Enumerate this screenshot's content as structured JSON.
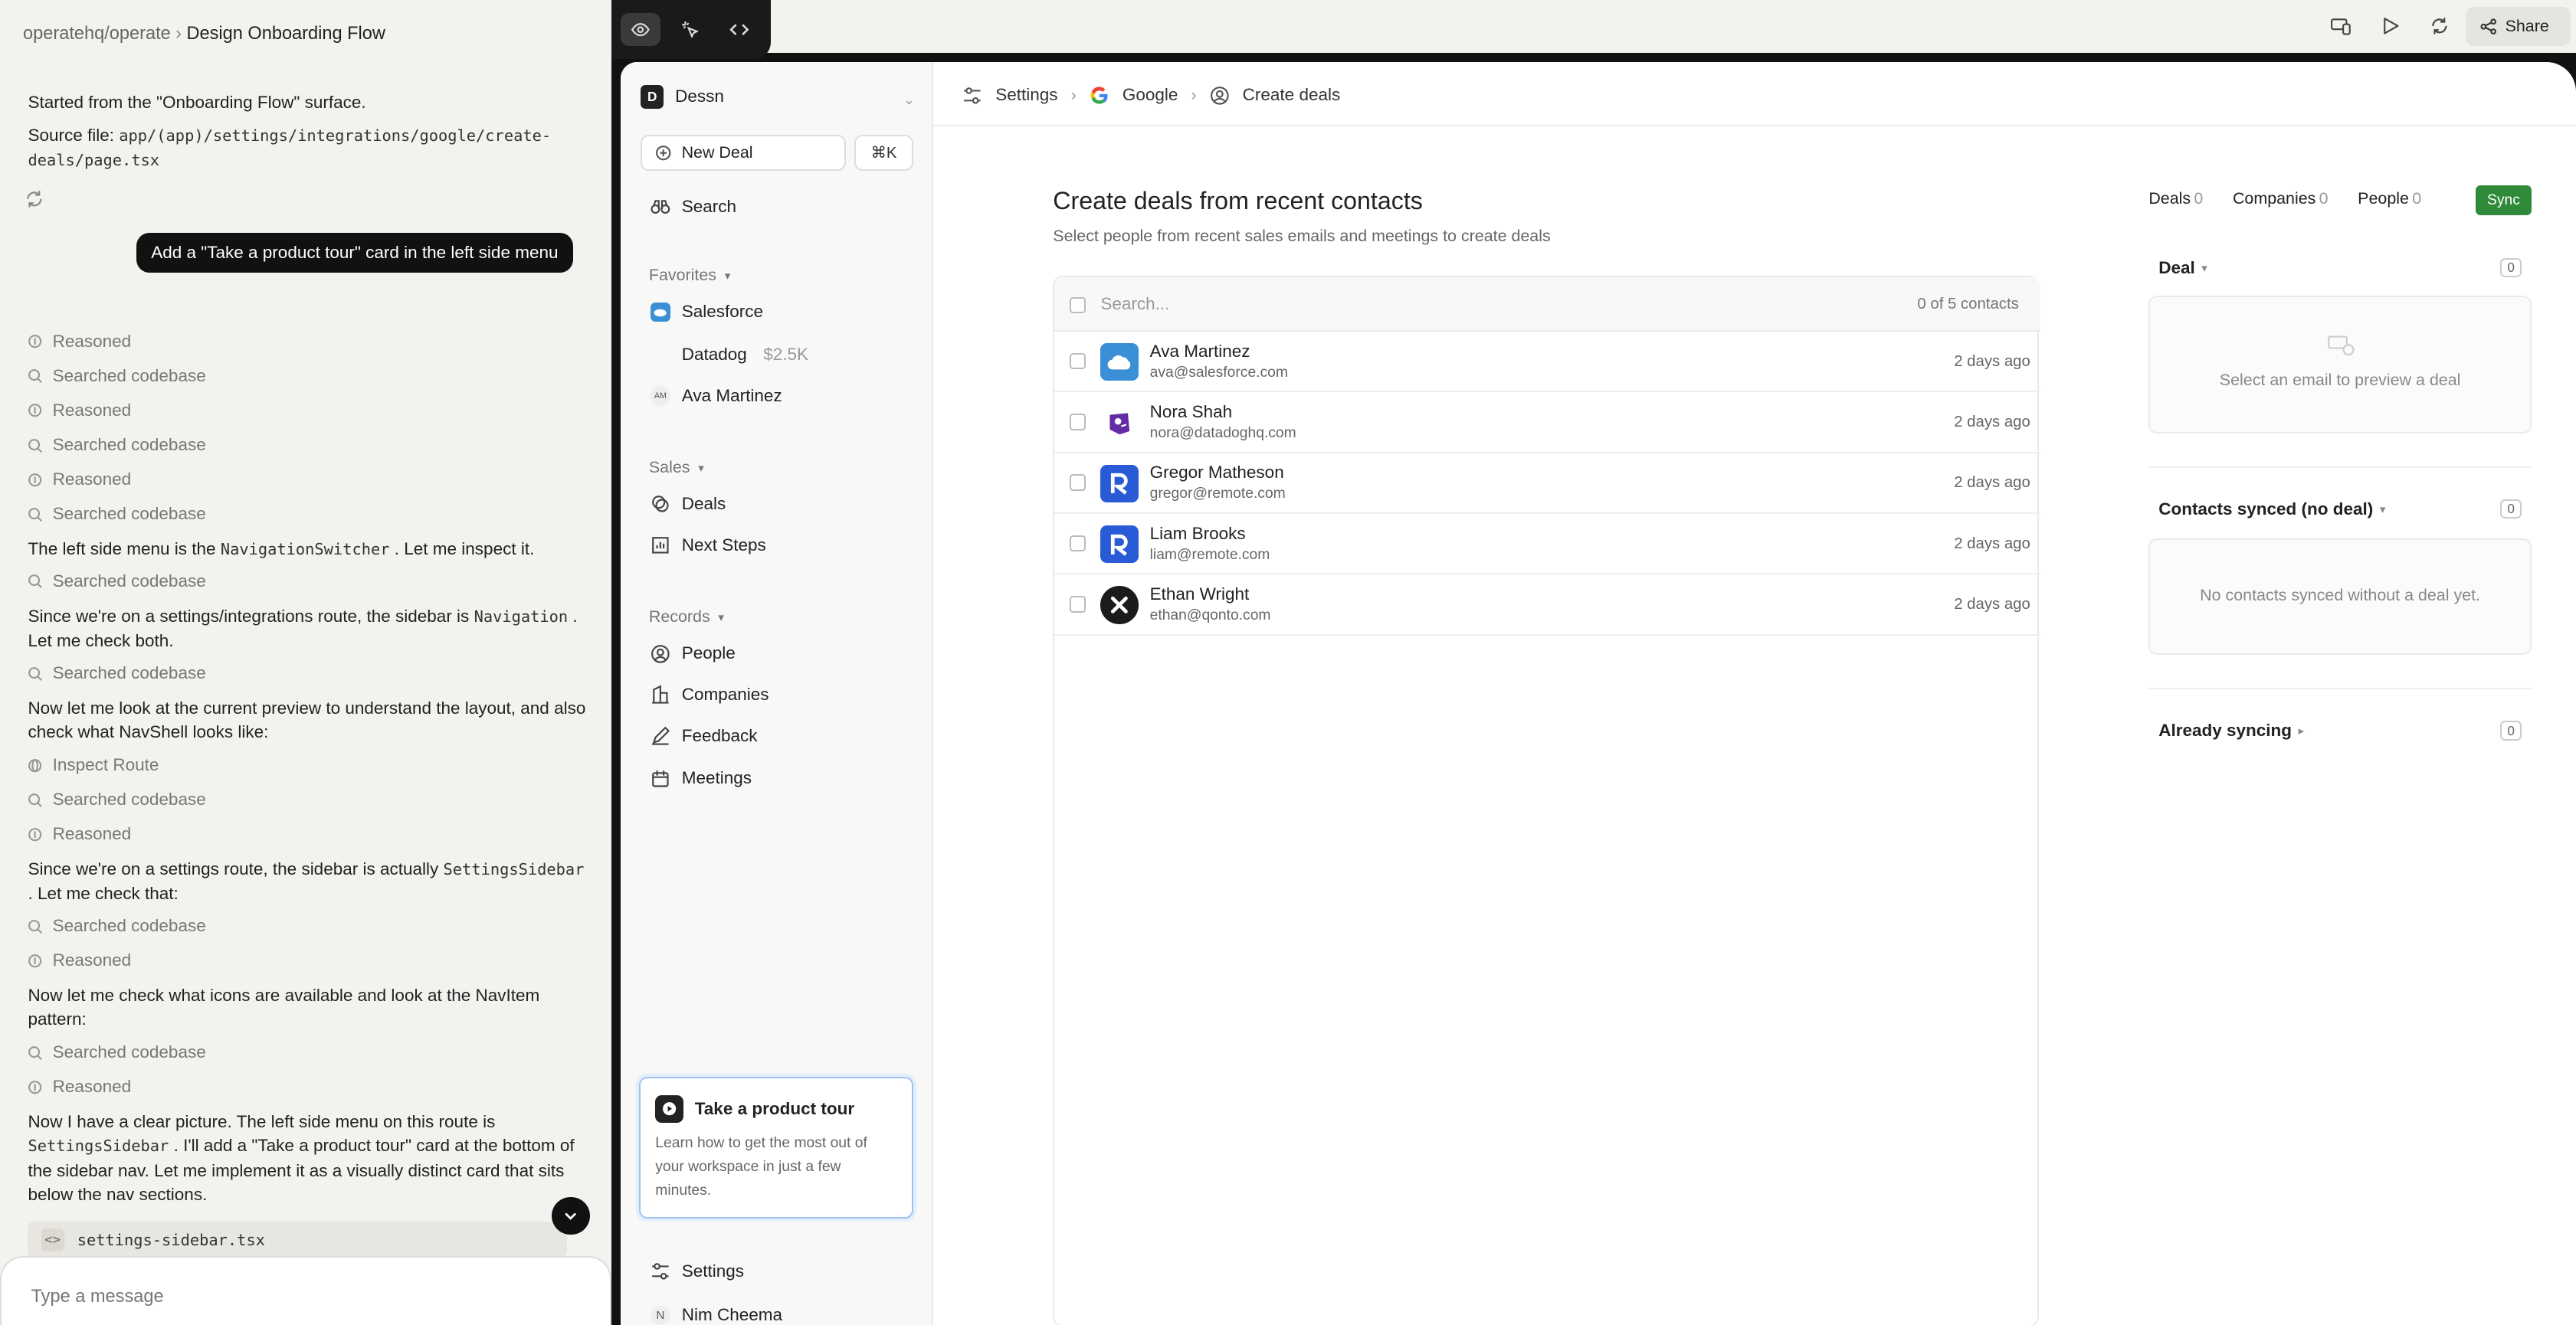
{
  "chat": {
    "repo": "operatehq/operate",
    "title": "Design Onboarding Flow",
    "intro_line1": "Started from the \"Onboarding Flow\" surface.",
    "source_label": "Source file:",
    "source_path": "app/(app)/settings/integrations/google/create-deals/page.tsx",
    "user_message": "Add a \"Take a product tour\" card in the left side menu",
    "steps": {
      "reasoned": "Reasoned",
      "searched": "Searched codebase",
      "inspect": "Inspect Route"
    },
    "p1_a": "The left side menu is the",
    "p1_code": "NavigationSwitcher",
    "p1_b": ". Let me inspect it.",
    "p2_a": "Since we're on a settings/integrations route, the sidebar is",
    "p2_code": "Navigation",
    "p2_b": ". Let me check both.",
    "p3": "Now let me look at the current preview to understand the layout, and also check what NavShell looks like:",
    "p4_a": "Since we're on a settings route, the sidebar is actually",
    "p4_code": "SettingsSidebar",
    "p4_b": ". Let me check that:",
    "p5": "Now let me check what icons are available and look at the NavItem pattern:",
    "p6_a": "Now I have a clear picture. The left side menu on this route is",
    "p6_code": "SettingsSidebar",
    "p6_b": ". I'll add a \"Take a product tour\" card at the bottom of the sidebar nav. Let me implement it as a visually distinct card that sits below the nav sections.",
    "file_chip": "settings-sidebar.tsx",
    "input_placeholder": "Type a message"
  },
  "toolbar": {
    "share_label": "Share"
  },
  "app": {
    "workspace": "Dessn",
    "workspace_initial": "D",
    "new_deal": "New Deal",
    "shortcut": "⌘K",
    "search": "Search",
    "favorites_label": "Favorites",
    "favorites": [
      {
        "label": "Salesforce",
        "price": ""
      },
      {
        "label": "Datadog",
        "price": "$2.5K"
      },
      {
        "label": "Ava Martinez",
        "price": ""
      }
    ],
    "avatar_initials": "AM",
    "sales_label": "Sales",
    "sales": [
      "Deals",
      "Next Steps"
    ],
    "records_label": "Records",
    "records": [
      "People",
      "Companies",
      "Feedback",
      "Meetings"
    ],
    "tour_title": "Take a product tour",
    "tour_desc": "Learn how to get the most out of your workspace in just a few minutes.",
    "settings": "Settings",
    "user_initial": "N",
    "user_name": "Nim Cheema"
  },
  "breadcrumb": [
    "Settings",
    "Google",
    "Create deals"
  ],
  "page": {
    "title": "Create deals from recent contacts",
    "subtitle": "Select people from recent sales emails and meetings to create deals",
    "search_placeholder": "Search...",
    "count": "0 of 5 contacts",
    "contacts": [
      {
        "name": "Ava Martinez",
        "email": "ava@salesforce.com",
        "time": "2 days ago",
        "color": "#3b8fd6"
      },
      {
        "name": "Nora Shah",
        "email": "nora@datadoghq.com",
        "time": "2 days ago",
        "color": "#632ca6"
      },
      {
        "name": "Gregor Matheson",
        "email": "gregor@remote.com",
        "time": "2 days ago",
        "color": "#2a5bd7"
      },
      {
        "name": "Liam Brooks",
        "email": "liam@remote.com",
        "time": "2 days ago",
        "color": "#2a5bd7"
      },
      {
        "name": "Ethan Wright",
        "email": "ethan@qonto.com",
        "time": "2 days ago",
        "color": "#1b1b1b"
      }
    ]
  },
  "right": {
    "tabs": [
      {
        "label": "Deals",
        "count": "0"
      },
      {
        "label": "Companies",
        "count": "0"
      },
      {
        "label": "People",
        "count": "0"
      }
    ],
    "sync": "Sync",
    "deal_label": "Deal",
    "deal_count": "0",
    "deal_empty": "Select an email to preview a deal",
    "synced_label": "Contacts synced (no deal)",
    "synced_count": "0",
    "synced_empty": "No contacts synced without a deal yet.",
    "already_label": "Already syncing",
    "already_count": "0"
  }
}
